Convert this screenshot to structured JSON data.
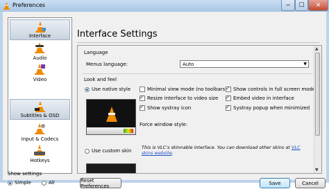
{
  "window": {
    "title": "Preferences",
    "controls": {
      "minimize": "−",
      "maximize": "☐",
      "close": "✕"
    }
  },
  "sidebar": {
    "items": [
      {
        "label": "Interface",
        "icon": "interface-cone-icon",
        "selected": true
      },
      {
        "label": "Audio",
        "icon": "audio-cone-icon",
        "selected": false
      },
      {
        "label": "Video",
        "icon": "video-cone-icon",
        "selected": false
      },
      {
        "label": "Subtitles & OSD",
        "icon": "subtitles-cone-icon",
        "selected": true
      },
      {
        "label": "Input & Codecs",
        "icon": "input-codecs-icon",
        "selected": false
      },
      {
        "label": "Hotkeys",
        "icon": "hotkeys-cone-icon",
        "selected": false
      }
    ],
    "show_settings": {
      "label": "Show settings",
      "simple_label": "Simple",
      "all_label": "All",
      "selected": "Simple"
    }
  },
  "page": {
    "title": "Interface Settings",
    "language": {
      "group_label": "Language",
      "menus_language_label": "Menus language:",
      "menus_language_value": "Auto"
    },
    "look_and_feel": {
      "group_label": "Look and feel",
      "use_native_style": "Use native style",
      "options_col1": [
        {
          "label": "Minimal view mode (no toolbars)",
          "checked": false
        },
        {
          "label": "Resize interface to video size",
          "checked": true
        },
        {
          "label": "Show systray icon",
          "checked": true
        }
      ],
      "options_col2": [
        {
          "label": "Show controls in full screen mode",
          "checked": true
        },
        {
          "label": "Embed video in interface",
          "checked": true
        },
        {
          "label": "Systray popup when minimized",
          "checked": true
        }
      ],
      "force_window_style_label": "Force window style:",
      "skin_note_text": "This is VLC's skinnable interface. You can download other skins at ",
      "skin_note_link": "VLC skins website",
      "skin_note_end": ".",
      "use_custom_skin": "Use custom skin"
    }
  },
  "footer": {
    "reset_label": "Reset Preferences",
    "save_label": "Save",
    "cancel_label": "Cancel"
  },
  "colors": {
    "titlebar": "#bcd3ea",
    "selection": "#c9d4df",
    "vlc_orange": "#f08a00",
    "link": "#1a4ec8"
  }
}
